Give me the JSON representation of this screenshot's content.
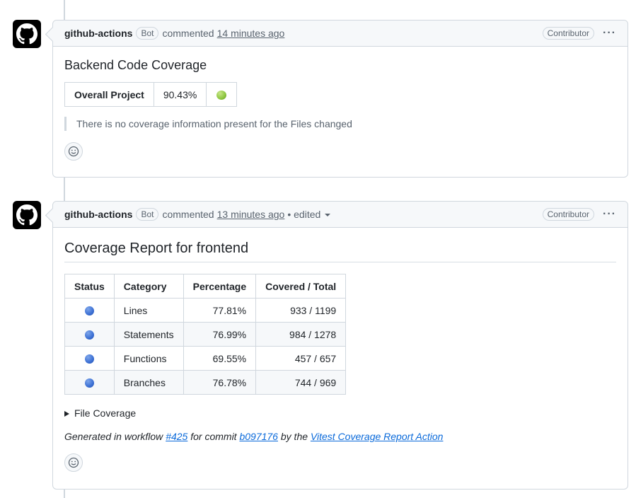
{
  "comment1": {
    "author": "github-actions",
    "badge": "Bot",
    "action": "commented",
    "time": "14 minutes ago",
    "role": "Contributor",
    "menu": "···",
    "title": "Backend Code Coverage",
    "table": {
      "label": "Overall Project",
      "value": "90.43%"
    },
    "quote": "There is no coverage information present for the Files changed"
  },
  "comment2": {
    "author": "github-actions",
    "badge": "Bot",
    "action": "commented",
    "time": "13 minutes ago",
    "edited": "• edited",
    "role": "Contributor",
    "menu": "···",
    "title": "Coverage Report for frontend",
    "headers": [
      "Status",
      "Category",
      "Percentage",
      "Covered / Total"
    ],
    "rows": [
      {
        "category": "Lines",
        "percentage": "77.81%",
        "covered": "933 / 1199"
      },
      {
        "category": "Statements",
        "percentage": "76.99%",
        "covered": "984 / 1278"
      },
      {
        "category": "Functions",
        "percentage": "69.55%",
        "covered": "457 / 657"
      },
      {
        "category": "Branches",
        "percentage": "76.78%",
        "covered": "744 / 969"
      }
    ],
    "details": "File Coverage",
    "footer": {
      "t1": "Generated in workflow ",
      "workflow": "#425",
      "t2": " for commit ",
      "commit": "b097176",
      "t3": " by the ",
      "action_link": "Vitest Coverage Report Action"
    }
  },
  "icons": {
    "avatar": "github-mark-icon",
    "reaction": "smiley-icon",
    "status": "blue-circle-icon",
    "overall_status": "green-apple-icon"
  }
}
